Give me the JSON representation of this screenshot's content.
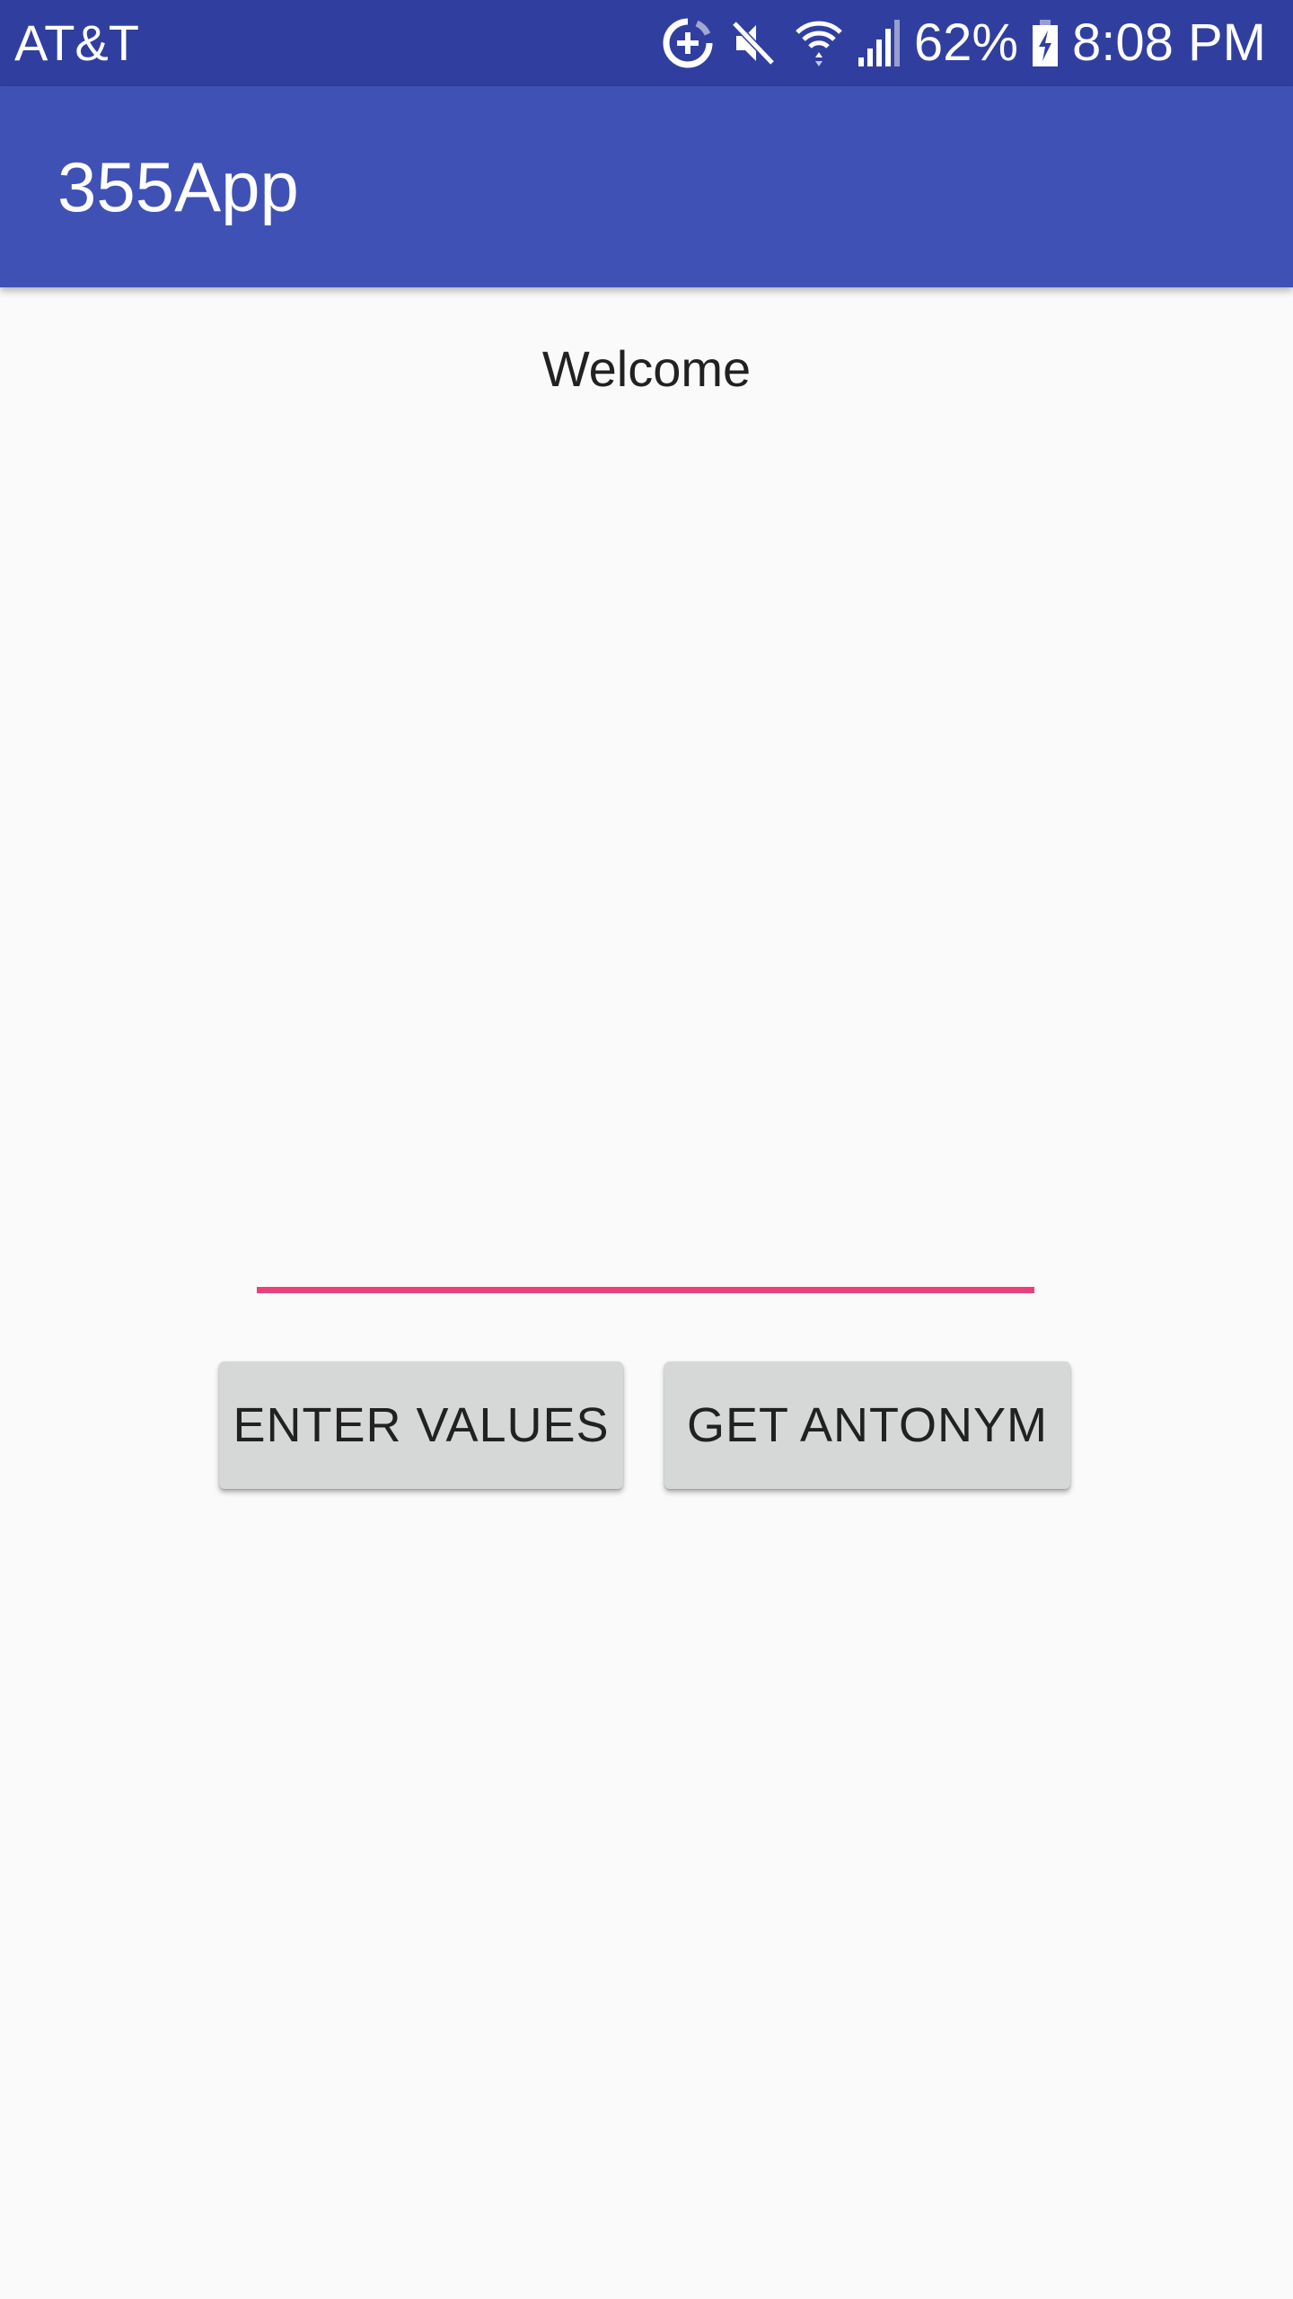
{
  "status_bar": {
    "carrier": "AT&T",
    "battery_percent": "62%",
    "time": "8:08 PM",
    "icons": [
      "data-saver-icon",
      "mute-icon",
      "wifi-icon",
      "signal-icon",
      "battery-charging-icon"
    ],
    "background_color": "#303f9f"
  },
  "app_bar": {
    "title": "355App",
    "background_color": "#3f51b5"
  },
  "main": {
    "welcome_text": "Welcome",
    "input": {
      "value": "",
      "placeholder": "",
      "underline_color": "#ec407a"
    },
    "buttons": {
      "enter_values": "ENTER VALUES",
      "get_antonym": "GET ANTONYM"
    }
  }
}
